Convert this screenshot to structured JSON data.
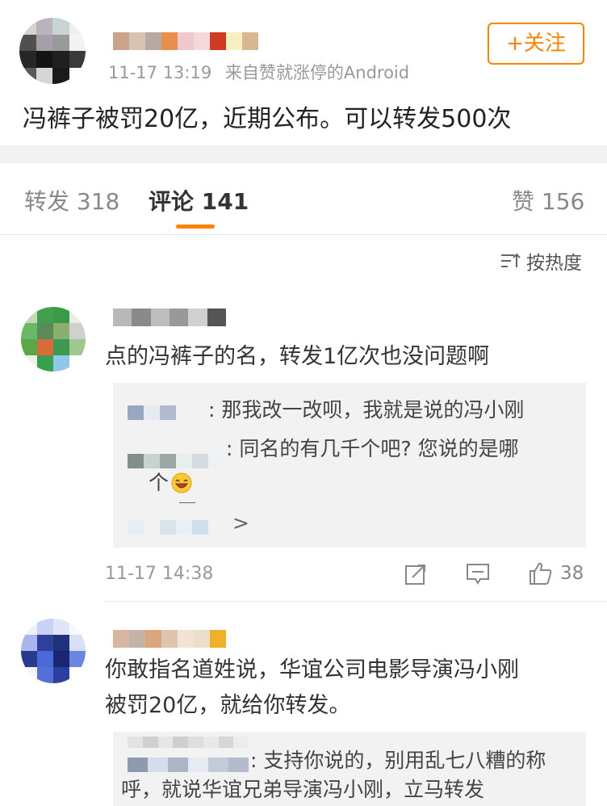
{
  "post": {
    "time": "11-17 13:19",
    "source": "来自赞就涨停的Android",
    "text": "冯裤子被罚20亿，近期公布。可以转发500次",
    "follow_label": "+关注"
  },
  "tabs": {
    "repost": "转发 318",
    "comments": "评论 141",
    "likes": "赞 156"
  },
  "sort": {
    "label": "按热度"
  },
  "comments": [
    {
      "text": "点的冯裤子的名，转发1亿次也没问题啊",
      "replies": [
        {
          "text": ": 那我改一改呗，我就是说的冯小刚"
        },
        {
          "text_line1": ": 同名的有几千个吧? 您说的是哪",
          "text_line2": "个"
        }
      ],
      "more": ">",
      "time": "11-17 14:38",
      "likes": "38"
    },
    {
      "text_line1": "你敢指名道姓说，华谊公司电影导演冯小刚",
      "text_line2": "被罚20亿，就给你转发。",
      "replies": [
        {
          "text_line1": ": 支持你说的，别用乱七八糟的称",
          "text_line2": "呼，就说华谊兄弟导演冯小刚，立马转发"
        }
      ]
    }
  ],
  "colors": {
    "accent": "#ff8200",
    "band": "#f2f2f2",
    "reply_bg": "#f2f2f2"
  },
  "icons": [
    "share-icon",
    "comment-icon",
    "thumb-up-icon",
    "sort-icon",
    "grin-emoji-icon"
  ]
}
